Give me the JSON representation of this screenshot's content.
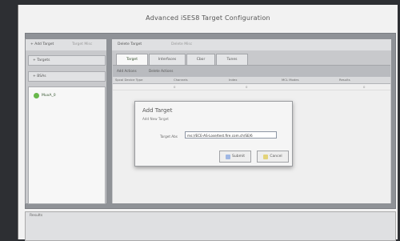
{
  "app": {
    "title": "Advanced iSES8 Target Configuration"
  },
  "left_panel": {
    "toolbar": {
      "add_target": "+ Add Target",
      "target_misc": "Target Misc"
    },
    "accordion": {
      "targets": "+ Targets",
      "bsas": "+ BSAs"
    },
    "items": [
      {
        "label": "MuxA_0"
      }
    ]
  },
  "right_panel": {
    "toolbar": {
      "delete_target": "Delete Target",
      "delete_misc": "Delete Misc"
    },
    "tabs": [
      "Target",
      "Interfaces",
      "Cbor",
      "Tunes"
    ],
    "bar": {
      "add_actions": "Add Actions",
      "delete_actions": "Delete Actions"
    },
    "grid": {
      "columns": [
        "Spcal Device Type",
        "Channels",
        "Index",
        "MCL Modes",
        "Results"
      ],
      "row": [
        "",
        "0",
        "0",
        "",
        "0"
      ]
    }
  },
  "modal": {
    "title": "Add Target",
    "subtitle": "Add New Target",
    "field_label": "Target Abs",
    "field_value": "ms://ECE-AS-Lose/test.fire.com.ch/SE/6",
    "submit": "Submit",
    "cancel": "Cancel"
  },
  "status": {
    "label": "Results"
  },
  "colors": {
    "accent_green": "#68b84c",
    "modal_bg": "#f5f5f5"
  }
}
